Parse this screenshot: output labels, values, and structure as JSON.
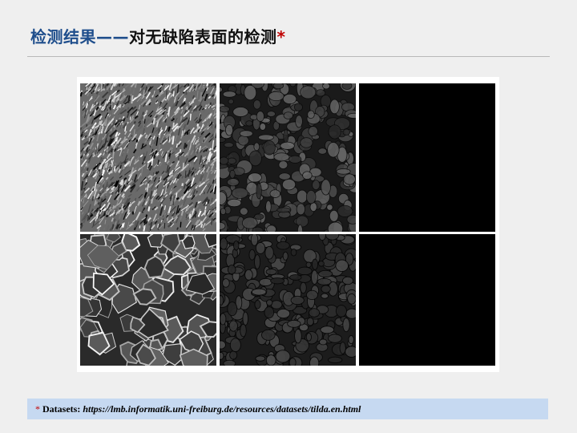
{
  "title": {
    "part1": "检测结果——",
    "part2": "对无缺陷表面的检测",
    "star": "*"
  },
  "footer": {
    "star": "*",
    "label": "Datasets:",
    "url": "https://lmb.informatik.uni-freiburg.de/resources/datasets/tilda.en.html"
  },
  "figure": {
    "rows": [
      {
        "name": "row-1",
        "tiles": [
          "fabric-texture-input",
          "fabric-texture-feature-map",
          "fabric-texture-detection-result"
        ]
      },
      {
        "name": "row-2",
        "tiles": [
          "cell-texture-input",
          "cell-texture-feature-map",
          "cell-texture-detection-result"
        ]
      }
    ]
  }
}
